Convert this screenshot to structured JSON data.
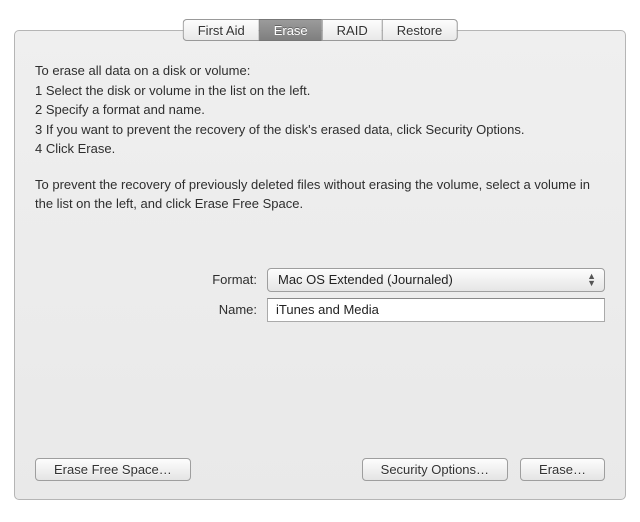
{
  "tabs": {
    "first_aid": "First Aid",
    "erase": "Erase",
    "raid": "RAID",
    "restore": "Restore",
    "active": "erase"
  },
  "instructions": {
    "heading": "To erase all data on a disk or volume:",
    "step1": "1  Select the disk or volume in the list on the left.",
    "step2": "2  Specify a format and name.",
    "step3": "3  If you want to prevent the recovery of the disk's erased data, click Security Options.",
    "step4": "4  Click Erase.",
    "para2": "To prevent the recovery of previously deleted files without erasing the volume, select a volume in the list on the left, and click Erase Free Space."
  },
  "form": {
    "format_label": "Format:",
    "format_value": "Mac OS Extended (Journaled)",
    "name_label": "Name:",
    "name_value": "iTunes and Media"
  },
  "buttons": {
    "erase_free_space": "Erase Free Space…",
    "security_options": "Security Options…",
    "erase": "Erase…"
  }
}
